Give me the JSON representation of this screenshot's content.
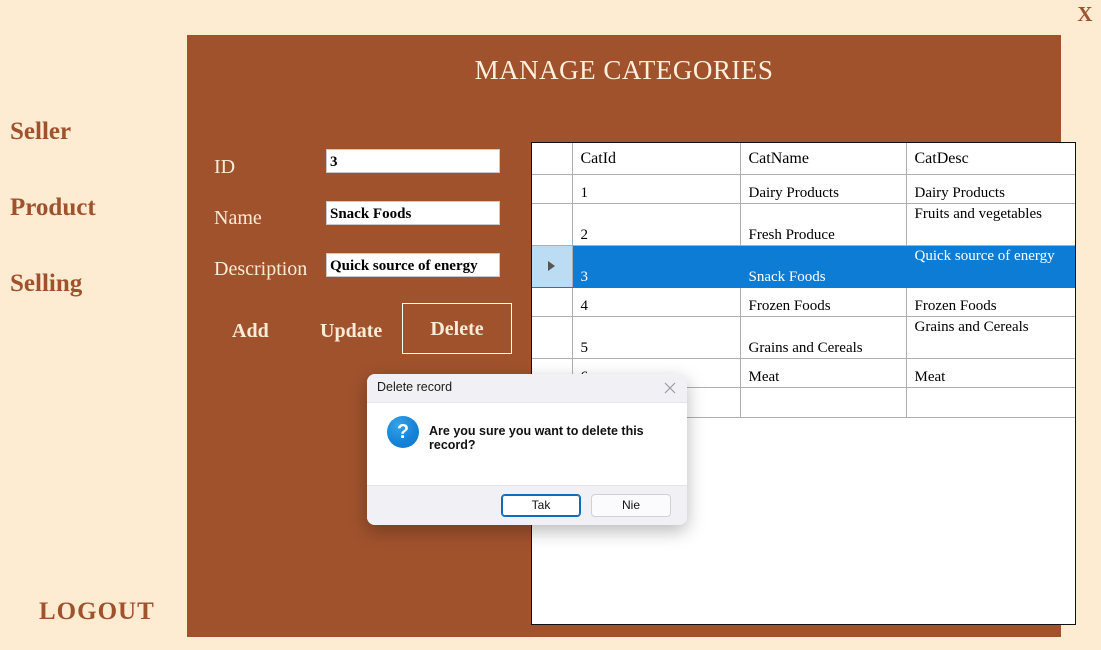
{
  "window": {
    "close_label": "X"
  },
  "sidebar": {
    "items": [
      {
        "label": "Seller"
      },
      {
        "label": "Product"
      },
      {
        "label": "Selling"
      }
    ],
    "logout_label": "LOGOUT"
  },
  "main": {
    "title": "MANAGE CATEGORIES",
    "form": {
      "fields": [
        {
          "label": "ID",
          "value": "3"
        },
        {
          "label": "Name",
          "value": "Snack Foods"
        },
        {
          "label": "Description",
          "value": "Quick source of energy"
        }
      ],
      "buttons": {
        "add": "Add",
        "update": "Update",
        "delete": "Delete"
      }
    },
    "grid": {
      "columns": [
        "CatId",
        "CatName",
        "CatDesc"
      ],
      "rows": [
        {
          "CatId": "1",
          "CatName": "Dairy Products",
          "CatDesc": "Dairy Products"
        },
        {
          "CatId": "2",
          "CatName": "Fresh Produce",
          "CatDesc": "Fruits and vegetables"
        },
        {
          "CatId": "3",
          "CatName": "Snack Foods",
          "CatDesc": "Quick source of energy"
        },
        {
          "CatId": "4",
          "CatName": "Frozen Foods",
          "CatDesc": "Frozen Foods"
        },
        {
          "CatId": "5",
          "CatName": "Grains and Cereals",
          "CatDesc": "Grains and Cereals"
        },
        {
          "CatId": "6",
          "CatName": "Meat",
          "CatDesc": "Meat"
        },
        {
          "CatId": "",
          "CatName": "",
          "CatDesc": ""
        }
      ],
      "selected_row_index": 2
    }
  },
  "dialog": {
    "title": "Delete record",
    "message": "Are you sure you want to delete this record?",
    "icon": "question-icon",
    "icon_glyph": "?",
    "yes_label": "Tak",
    "no_label": "Nie",
    "close_icon": "close-icon"
  },
  "colors": {
    "page_background": "#FDEBD2",
    "panel_brown": "#A0522D",
    "accent_text": "#A0522D",
    "cream_text": "#FAEBD7",
    "grid_selection_blue": "#0C7CD5",
    "grid_selection_header_blue": "#BBDCF2",
    "dialog_accent_blue": "#0F6CBD"
  }
}
